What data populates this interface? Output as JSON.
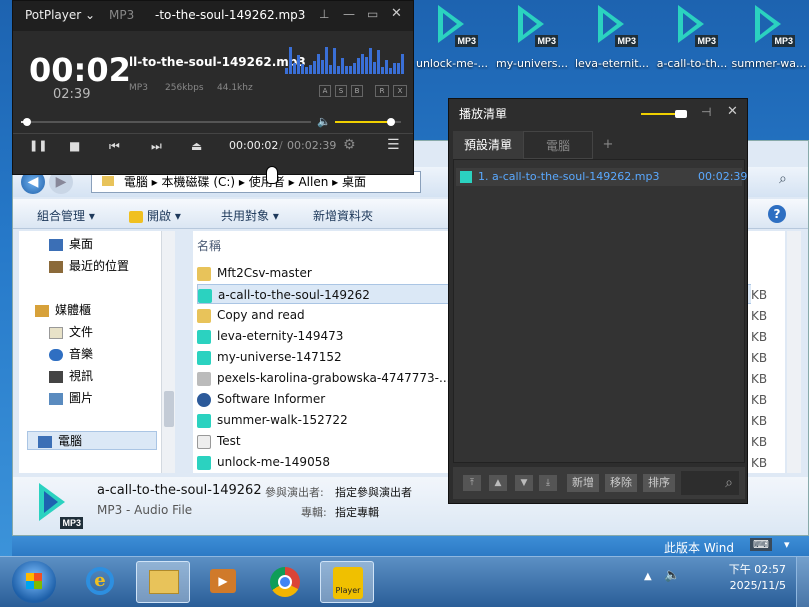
{
  "desktop": {
    "icons": [
      {
        "label": "unlock-me-...",
        "tag": "MP3"
      },
      {
        "label": "my-univers...",
        "tag": "MP3"
      },
      {
        "label": "leva-eternit...",
        "tag": "MP3"
      },
      {
        "label": "a-call-to-th...",
        "tag": "MP3"
      },
      {
        "label": "summer-wa...",
        "tag": "MP3"
      }
    ]
  },
  "potplayer": {
    "app": "PotPlayer",
    "format": "MP3",
    "title_scroll": "-to-the-soul-149262.mp3",
    "time_big": "00:02",
    "time_remain": "02:39",
    "track": "ll-to-the-soul-149262.mp3",
    "codec": "MP3",
    "bitrate": "256kbps",
    "freq": "44.1khz",
    "seek_fraction": 0.02,
    "volume_fraction": 0.85,
    "pos": "00:00:02",
    "sep": "/",
    "dur": "00:02:39",
    "mini_btns": [
      "A",
      "S",
      "B",
      "R",
      "X"
    ]
  },
  "playlist": {
    "title": "播放清單",
    "tabs": [
      "預設清單",
      "電腦",
      "+"
    ],
    "items": [
      {
        "name": "1. a-call-to-the-soul-149262.mp3",
        "time": "00:02:39"
      }
    ],
    "buttons": [
      "新增",
      "移除",
      "排序"
    ]
  },
  "explorer": {
    "breadcrumb": [
      "電腦",
      "本機磁碟 (C:)",
      "使用者",
      "Allen",
      "桌面"
    ],
    "toolbar": [
      "組合管理",
      "開啟",
      "共用對象",
      "新增資料夾"
    ],
    "column": "名稱",
    "nav": [
      {
        "label": "桌面",
        "color": "#3b6fb6"
      },
      {
        "label": "最近的位置",
        "color": "#8b6a3a"
      },
      {
        "label": "媒體櫃",
        "color": "#d7a13a"
      },
      {
        "label": "文件",
        "color": "#e8e2c8"
      },
      {
        "label": "音樂",
        "color": "#2f6fc2"
      },
      {
        "label": "視訊",
        "color": "#444444"
      },
      {
        "label": "圖片",
        "color": "#5a8bbf"
      },
      {
        "label": "電腦",
        "color": "#3b6fb6"
      }
    ],
    "files": [
      {
        "name": "Mft2Csv-master",
        "color": "#e8c35a"
      },
      {
        "name": "a-call-to-the-soul-149262",
        "color": "#2bd2c0"
      },
      {
        "name": "Copy and read",
        "color": "#eeeeee"
      },
      {
        "name": "leva-eternity-149473",
        "color": "#2bd2c0"
      },
      {
        "name": "my-universe-147152",
        "color": "#2bd2c0"
      },
      {
        "name": "pexels-karolina-grabowska-4747773-...",
        "color": "#bbbbbb"
      },
      {
        "name": "Software Informer",
        "color": "#2c5a9a"
      },
      {
        "name": "summer-walk-152722",
        "color": "#2bd2c0"
      },
      {
        "name": "Test",
        "color": "#eeeeee"
      },
      {
        "name": "unlock-me-149058",
        "color": "#2bd2c0"
      }
    ],
    "size_unit": "KB",
    "details": {
      "name": "a-call-to-the-soul-149262",
      "type": "MP3 - Audio File",
      "artist_label": "參與演出者:",
      "artist_value": "指定參與演出者",
      "album_label": "專輯:",
      "album_value": "指定專輯"
    }
  },
  "taskbar": {
    "watermark": "此版本 Wind",
    "time": "下午 02:57",
    "date": "2025/11/5",
    "potplayer_label": "Player"
  }
}
